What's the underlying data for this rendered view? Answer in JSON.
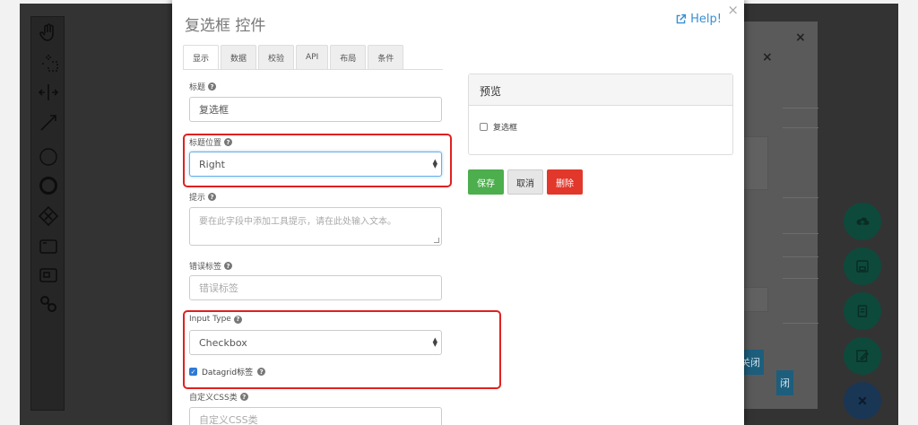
{
  "modal": {
    "title": "复选框 控件",
    "help_label": "Help!",
    "close_glyph": "×"
  },
  "tabs": [
    {
      "label": "显示"
    },
    {
      "label": "数据"
    },
    {
      "label": "校验"
    },
    {
      "label": "API"
    },
    {
      "label": "布局"
    },
    {
      "label": "条件"
    }
  ],
  "form": {
    "title_label": "标题",
    "title_value": "复选框",
    "title_position_label": "标题位置",
    "title_position_value": "Right",
    "tooltip_label": "提示",
    "tooltip_placeholder": "要在此字段中添加工具提示，请在此处输入文本。",
    "error_label_label": "错误标签",
    "error_label_placeholder": "错误标签",
    "input_type_label": "Input Type",
    "input_type_value": "Checkbox",
    "datagrid_label": "Datagrid标签",
    "custom_css_label": "自定义CSS类",
    "custom_css_placeholder": "自定义CSS类"
  },
  "preview": {
    "heading": "预览",
    "checkbox_label": "复选框"
  },
  "actions": {
    "save": "保存",
    "cancel": "取消",
    "delete": "删除"
  },
  "background": {
    "close_button_label": "关闭",
    "close_button_label_2": "闭"
  },
  "colors": {
    "primary": "#3a8fd0",
    "success": "#4cae4c",
    "danger": "#e2372b",
    "highlight": "#e02020"
  }
}
